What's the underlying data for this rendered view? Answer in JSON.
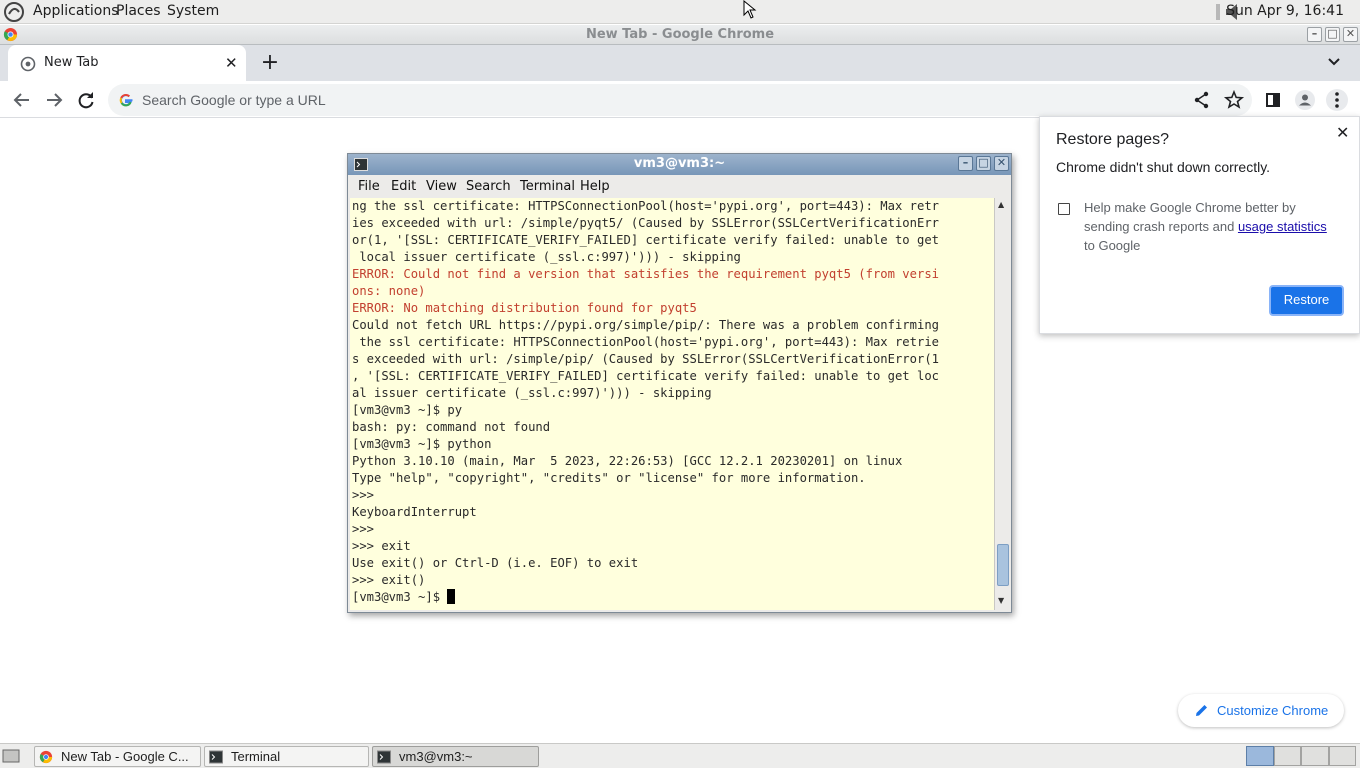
{
  "top_panel": {
    "menus": [
      "Applications",
      "Places",
      "System"
    ],
    "clock": "Sun Apr  9, 16:41"
  },
  "chrome": {
    "window_title": "New Tab - Google Chrome",
    "tab_title": "New Tab",
    "omnibox_placeholder": "Search Google or type a URL",
    "restore_bubble": {
      "title": "Restore pages?",
      "message": "Chrome didn't shut down correctly.",
      "checkbox_text": "Help make Google Chrome better by sending crash reports and",
      "checkbox_link": "usage statistics",
      "checkbox_suffix": "to Google",
      "restore_button": "Restore"
    },
    "customize_button": "Customize Chrome"
  },
  "terminal": {
    "title": "vm3@vm3:~",
    "menus": [
      "File",
      "Edit",
      "View",
      "Search",
      "Terminal",
      "Help"
    ],
    "lines": [
      {
        "text": "ng the ssl certificate: HTTPSConnectionPool(host='pypi.org', port=443): Max retr",
        "err": false
      },
      {
        "text": "ies exceeded with url: /simple/pyqt5/ (Caused by SSLError(SSLCertVerificationErr",
        "err": false
      },
      {
        "text": "or(1, '[SSL: CERTIFICATE_VERIFY_FAILED] certificate verify failed: unable to get",
        "err": false
      },
      {
        "text": " local issuer certificate (_ssl.c:997)'))) - skipping",
        "err": false
      },
      {
        "text": "ERROR: Could not find a version that satisfies the requirement pyqt5 (from versi",
        "err": true
      },
      {
        "text": "ons: none)",
        "err": true
      },
      {
        "text": "ERROR: No matching distribution found for pyqt5",
        "err": true
      },
      {
        "text": "Could not fetch URL https://pypi.org/simple/pip/: There was a problem confirming",
        "err": false
      },
      {
        "text": " the ssl certificate: HTTPSConnectionPool(host='pypi.org', port=443): Max retrie",
        "err": false
      },
      {
        "text": "s exceeded with url: /simple/pip/ (Caused by SSLError(SSLCertVerificationError(1",
        "err": false
      },
      {
        "text": ", '[SSL: CERTIFICATE_VERIFY_FAILED] certificate verify failed: unable to get loc",
        "err": false
      },
      {
        "text": "al issuer certificate (_ssl.c:997)'))) - skipping",
        "err": false
      },
      {
        "text": "[vm3@vm3 ~]$ py",
        "err": false
      },
      {
        "text": "bash: py: command not found",
        "err": false
      },
      {
        "text": "[vm3@vm3 ~]$ python",
        "err": false
      },
      {
        "text": "Python 3.10.10 (main, Mar  5 2023, 22:26:53) [GCC 12.2.1 20230201] on linux",
        "err": false
      },
      {
        "text": "Type \"help\", \"copyright\", \"credits\" or \"license\" for more information.",
        "err": false
      },
      {
        "text": ">>>",
        "err": false
      },
      {
        "text": "KeyboardInterrupt",
        "err": false
      },
      {
        "text": ">>>",
        "err": false
      },
      {
        "text": ">>> exit",
        "err": false
      },
      {
        "text": "Use exit() or Ctrl-D (i.e. EOF) to exit",
        "err": false
      },
      {
        "text": ">>> exit()",
        "err": false
      }
    ],
    "prompt": "[vm3@vm3 ~]$ "
  },
  "taskbar": {
    "tasks": [
      {
        "label": "New Tab - Google C...",
        "icon": "chrome-icon",
        "active": false
      },
      {
        "label": "Terminal",
        "icon": "terminal-icon",
        "active": false
      },
      {
        "label": "vm3@vm3:~",
        "icon": "terminal-icon",
        "active": true
      }
    ]
  },
  "colors": {
    "terminal_bg": "#ffffdd",
    "error_text": "#c2402f",
    "accent": "#1a73e8"
  }
}
